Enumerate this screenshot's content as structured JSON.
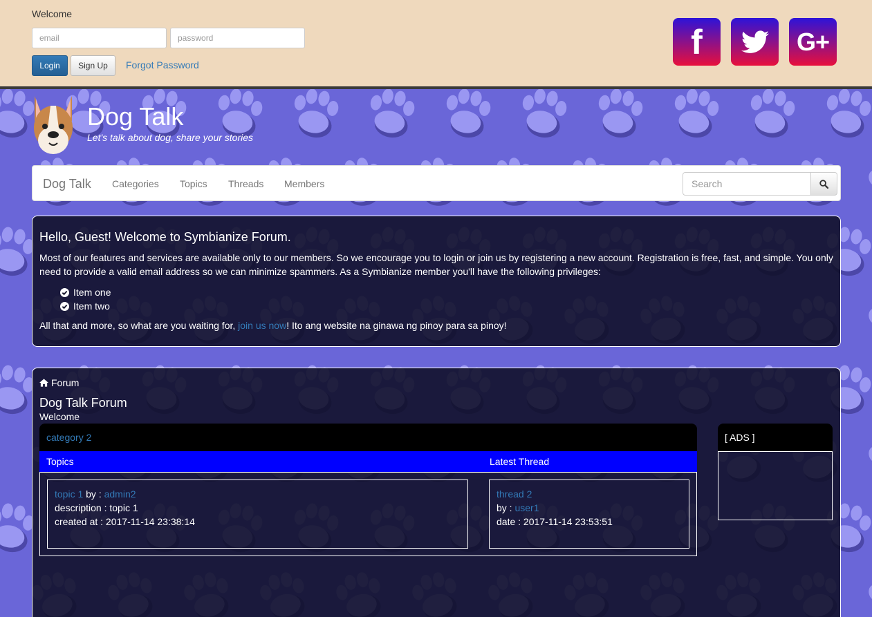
{
  "topbar": {
    "welcome": "Welcome",
    "email_placeholder": "email",
    "password_placeholder": "password",
    "login_label": "Login",
    "signup_label": "Sign Up",
    "forgot_label": "Forgot Password"
  },
  "social": {
    "facebook_glyph": "f",
    "google_glyph": "G+",
    "icons": [
      "facebook-icon",
      "twitter-icon",
      "google-plus-icon"
    ]
  },
  "header": {
    "title": "Dog Talk",
    "tagline": "Let's talk about dog, share your stories"
  },
  "navbar": {
    "brand": "Dog Talk",
    "links": [
      "Categories",
      "Topics",
      "Threads",
      "Members"
    ],
    "search_placeholder": "Search"
  },
  "welcome_panel": {
    "heading": "Hello, Guest! Welcome to Symbianize Forum.",
    "intro": "Most of our features and services are available only to our members. So we encourage you to login or join us by registering a new account. Registration is free, fast, and simple. You only need to provide a valid email address so we can minimize spammers. As a Symbianize member you'll have the following privileges:",
    "items": [
      "Item one",
      "Item two"
    ],
    "outro_before": "All that and more, so what are you waiting for, ",
    "outro_link": "join us now",
    "outro_after": "! Ito ang website na ginawa ng pinoy para sa pinoy!"
  },
  "forum": {
    "breadcrumb": "Forum",
    "title": "Dog Talk Forum",
    "subtitle": "Welcome",
    "category": "category 2",
    "col_topics": "Topics",
    "col_latest": "Latest Thread",
    "topic": {
      "name": "topic 1",
      "by_label": " by : ",
      "author": "admin2",
      "description": "description : topic 1",
      "created": "created at : 2017-11-14 23:38:14"
    },
    "thread": {
      "name": "thread 2",
      "by_label": "by : ",
      "author": "user1",
      "date": "date : 2017-11-14 23:53:51"
    },
    "ads_label": "[ ADS ]"
  },
  "colors": {
    "topbar_bg": "#efd9bd",
    "page_bg": "#6a66d8",
    "paw": "#9a97f2",
    "link": "#337ab7",
    "column_header": "#0000ff",
    "social_gradient_top": "#2d13d8",
    "social_gradient_bottom": "#e8103c"
  }
}
